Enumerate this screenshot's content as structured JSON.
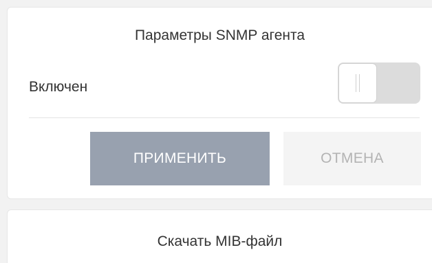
{
  "snmp_card": {
    "title": "Параметры SNMP агента",
    "enabled_label": "Включен",
    "enabled": false,
    "apply_label": "ПРИМЕНИТЬ",
    "cancel_label": "ОТМЕНА"
  },
  "mib_card": {
    "download_label": "Скачать MIB-файл"
  },
  "colors": {
    "apply_button_bg": "#98a1af",
    "cancel_button_bg": "#f4f4f4",
    "toggle_track": "#dcdcdc"
  }
}
